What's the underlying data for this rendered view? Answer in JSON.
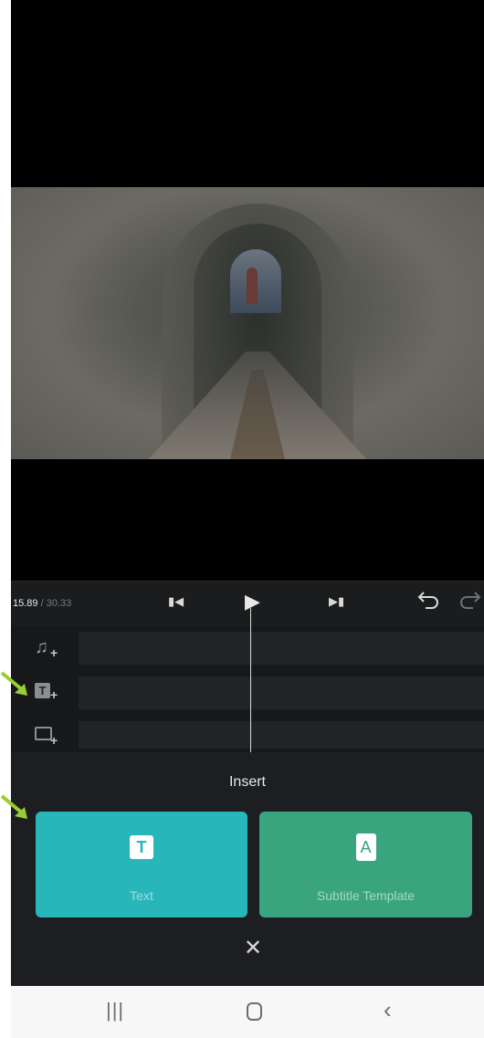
{
  "playback": {
    "current_time": "15.89",
    "separator": " / ",
    "total_time": "30.33"
  },
  "controls": {
    "skip_back_icon": "skip-to-start-icon",
    "play_icon": "play-icon",
    "skip_forward_icon": "skip-to-end-icon",
    "undo_icon": "undo-icon",
    "redo_icon": "redo-icon"
  },
  "tracks": [
    {
      "icon": "add-music-icon"
    },
    {
      "icon": "add-text-icon",
      "glyph": "T"
    },
    {
      "icon": "add-overlay-icon"
    }
  ],
  "insert_sheet": {
    "title": "Insert",
    "options": [
      {
        "label": "Text",
        "icon_glyph": "T",
        "color": "#28b6bb"
      },
      {
        "label": "Subtitle Template",
        "icon_glyph": "A",
        "color": "#3aa47e"
      }
    ],
    "close_glyph": "✕"
  },
  "navbar": {
    "recent_glyph": "|||",
    "back_glyph": "‹"
  },
  "colors": {
    "annotation_arrow": "#9acd32",
    "sheet_background": "#1d1e21"
  }
}
